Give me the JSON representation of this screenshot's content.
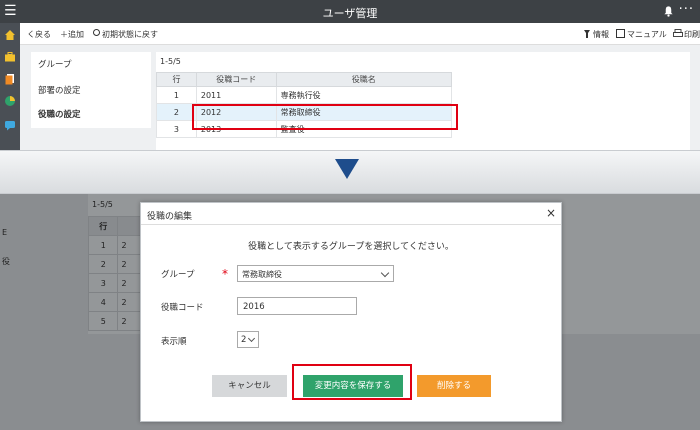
{
  "titlebar": {
    "menu_glyph": "☰",
    "title": "ユーザ管理",
    "more_glyph": "···"
  },
  "toolbar": {
    "back": "く戻る",
    "add": "＋追加",
    "reset": "初期状態に戻す",
    "info": "情報",
    "manual": "マニュアル",
    "print": "印刷"
  },
  "subnav": {
    "group": "グループ",
    "department": "部署の設定",
    "position": "役職の設定"
  },
  "table": {
    "count": "1-5/5",
    "headers": {
      "row": "行",
      "code": "役職コード",
      "name": "役職名"
    },
    "rows": [
      {
        "row": "1",
        "code": "2011",
        "name": "専務執行役"
      },
      {
        "row": "2",
        "code": "2012",
        "name": "常務取締役"
      },
      {
        "row": "3",
        "code": "2013",
        "name": "監査役"
      }
    ]
  },
  "background": {
    "count": "1-5/5",
    "header": "行",
    "rows": [
      "1",
      "2",
      "3",
      "4",
      "5"
    ],
    "col2": "2",
    "side": [
      "E",
      "役"
    ]
  },
  "modal": {
    "title": "役職の編集",
    "close": "×",
    "instruction": "役職として表示するグループを選択してください。",
    "group_label": "グループ",
    "required_mark": "*",
    "group_value": "常務取締役",
    "code_label": "役職コード",
    "code_value": "2016",
    "order_label": "表示順",
    "order_value": "2",
    "cancel": "キャンセル",
    "save": "変更内容を保存する",
    "delete": "削除する"
  },
  "colors": {
    "highlight": "#e00012",
    "save": "#2fa36b",
    "delete": "#f39a2c",
    "arrow": "#1e4d8c",
    "titlebar": "#3d4145"
  },
  "icons": [
    "home-icon",
    "briefcase-icon",
    "copy-icon",
    "pie-chart-icon",
    "chat-icon",
    "bell-icon",
    "info-icon",
    "book-icon",
    "print-icon",
    "refresh-icon"
  ]
}
